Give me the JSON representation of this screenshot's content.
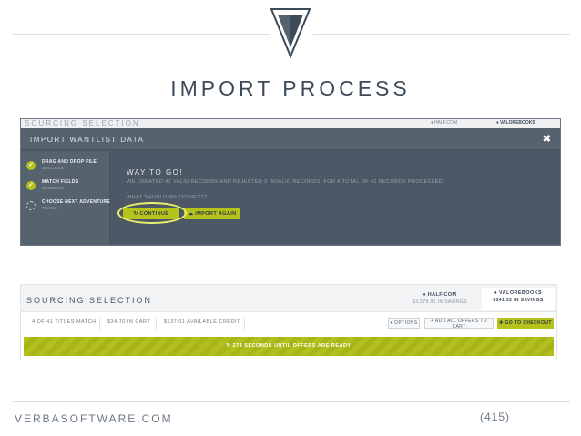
{
  "slide": {
    "title": "IMPORT PROCESS",
    "footer_site": "VERBASOFTWARE.COM",
    "page_number": "(415)",
    "accent": "#b4c21b"
  },
  "modal": {
    "underlay_title": "SOURCING SELECTION",
    "underlay_half": "♦ HALF.COM",
    "underlay_valore": "♦ VALOREBOOKS",
    "title": "IMPORT WANTLIST DATA",
    "close": "✖",
    "steps": [
      {
        "label": "DRAG AND DROP FILE",
        "sub": "SUCCESS",
        "done": true
      },
      {
        "label": "MATCH FIELDS",
        "sub": "SUCCESS",
        "done": true
      },
      {
        "label": "CHOOSE NEXT ADVENTURE",
        "sub": "TRANS",
        "done": false
      }
    ],
    "heading": "WAY TO GO!",
    "description": "WE CREATED 41 VALID RECORDS AND REJECTED 0 INVALID RECORDS, FOR A TOTAL OF 41 RECORDS PROCESSED.",
    "question": "WHAT SHOULD WE DO NEXT?",
    "continue_label": "↻ CONTINUE",
    "import_again_label": "☁ IMPORT AGAIN"
  },
  "sourcing": {
    "title": "SOURCING SELECTION",
    "half": {
      "name": "♦ HALF.COM",
      "savings": "$3,579.91 IN SAVINGS"
    },
    "valore": {
      "name": "♦ VALOREBOOKS",
      "savings": "$341.32 IN SAVINGS"
    },
    "titles_match": "4 OF 41 TITLES MATCH",
    "in_cart": "$34.70 IN CART",
    "available_credit": "$137.01 AVAILABLE CREDIT",
    "options_label": "▾ OPTIONS",
    "add_all_label": "+ ADD ALL OFFERS TO CART",
    "checkout_label": "✚ GO TO CHECKOUT",
    "countdown": "↻ 274 SECONDS UNTIL OFFERS ARE READY"
  }
}
